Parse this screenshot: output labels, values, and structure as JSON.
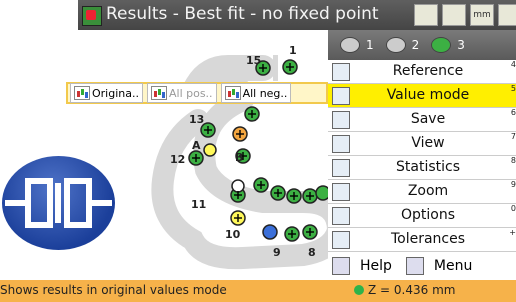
{
  "window": {
    "title": "Results - Best fit - no fixed point"
  },
  "title_icons": [
    "chart-icon",
    "bar-icon",
    "mm-label-icon",
    "dial-icon"
  ],
  "title_icon_texts": [
    "",
    "",
    "mm",
    ""
  ],
  "toolbar": {
    "original_label": "Origina..",
    "allpos_label": "All pos..",
    "allneg_label": "All neg.."
  },
  "menu": {
    "tabs": [
      {
        "label": "1",
        "icon": "chain-icon"
      },
      {
        "label": "2",
        "icon": "chain-icon"
      },
      {
        "label": "3",
        "icon": "green-circle-icon"
      }
    ],
    "items": [
      {
        "label": "Reference",
        "num": "4",
        "icon": "reference-icon"
      },
      {
        "label": "Value mode",
        "num": "5",
        "icon": "value-mode-icon",
        "active": true
      },
      {
        "label": "Save",
        "num": "6",
        "icon": "save-icon"
      },
      {
        "label": "View",
        "num": "7",
        "icon": "view-icon"
      },
      {
        "label": "Statistics",
        "num": "8",
        "icon": "statistics-icon"
      },
      {
        "label": "Zoom",
        "num": "9",
        "icon": "zoom-icon"
      },
      {
        "label": "Options",
        "num": "0",
        "icon": "options-icon"
      },
      {
        "label": "Tolerances",
        "num": "+",
        "icon": "tolerances-icon"
      }
    ],
    "help_label": "Help",
    "menu_label": "Menu"
  },
  "plot": {
    "labels": [
      "15",
      "1",
      "13",
      "A",
      "B",
      "12",
      "11",
      "10",
      "9",
      "8"
    ]
  },
  "status": {
    "left": "Shows results in original values mode",
    "right": "Z = 0.436 mm"
  },
  "colors": {
    "accent_yellow": "#ffef00",
    "status_orange": "#f6b24a",
    "logo_blue": "#2a4fb0",
    "point_green": "#3cb043"
  }
}
